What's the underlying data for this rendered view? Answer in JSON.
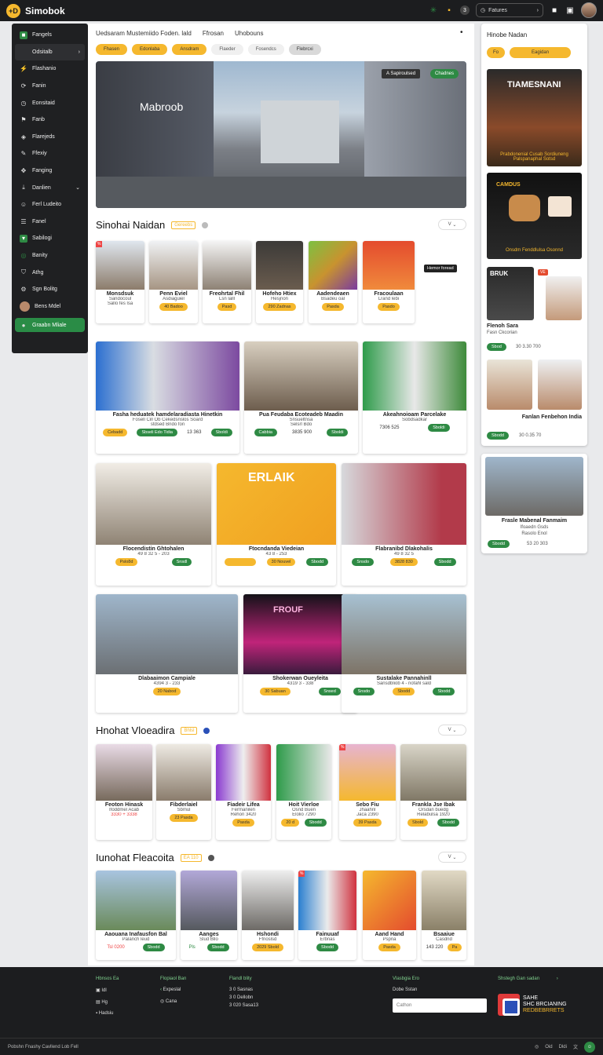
{
  "topbar": {
    "brand": "Simobok",
    "logo": "+D",
    "search_label": "Fatures",
    "icons": [
      "plant-icon",
      "clip-icon",
      "clock-icon",
      "search-icon",
      "bell-icon",
      "grid-icon",
      "avatar"
    ]
  },
  "sidebar": {
    "items": [
      {
        "label": "Fangels",
        "icon": "square-icon"
      },
      {
        "label": "Odsitalb",
        "icon": "chevron-right-icon"
      },
      {
        "label": "Flashanio",
        "icon": "flash-icon"
      },
      {
        "label": "Fanin",
        "icon": "refresh-icon"
      },
      {
        "label": "Eonsitaid",
        "icon": "clock-icon"
      },
      {
        "label": "Fanb",
        "icon": "flag-icon"
      },
      {
        "label": "Flarejeds",
        "icon": "tag-icon"
      },
      {
        "label": "Ffexiy",
        "icon": "spark-icon"
      },
      {
        "label": "Fanging",
        "icon": "puzzle-icon"
      },
      {
        "label": "Danlien",
        "icon": "arrow-down-icon"
      },
      {
        "label": "Ferl Ludeito",
        "icon": "user-icon"
      },
      {
        "label": "Fanel",
        "icon": "list-icon"
      },
      {
        "label": "Sabilogi",
        "icon": "green-square-icon"
      },
      {
        "label": "Banity",
        "icon": "ring-icon"
      },
      {
        "label": "Athg",
        "icon": "shield-icon"
      },
      {
        "label": "Sgn Bolitg",
        "icon": "settings-icon"
      },
      {
        "label": "Bens Mdel",
        "icon": "avatar"
      },
      {
        "label": "Graabn Mliale",
        "icon": "green-circle-icon"
      }
    ]
  },
  "main": {
    "header": {
      "title": "Uedsaram Mustemiido Foden. lald",
      "second": "Ffrosan",
      "third": "Uhobouns",
      "dot": "•"
    },
    "chips": [
      "Fhasen",
      "Edonlaba",
      "Ansdram",
      "Flaeder",
      "Fosendcs",
      "Flebrcxi"
    ],
    "hero": {
      "sign": "Mabroob",
      "tag1": "A Sapiroulsed",
      "tag2": "Chadnes"
    },
    "section1": {
      "title": "Sinohai Naidan",
      "badge": "Gereebs",
      "sort": "V"
    },
    "row1": [
      {
        "title": "Monsdsuk",
        "sub": "Sandocoul",
        "meta": "Sallo fes lsa",
        "btn": ""
      },
      {
        "title": "Penn Eviel",
        "sub": "Asdiaguiel",
        "meta": "",
        "btn": "40 Badoo"
      },
      {
        "title": "Freohrtal Fhil",
        "sub": "Lsn lalll",
        "meta": "",
        "btn": "Pasd"
      },
      {
        "title": "Hofeho Htiex",
        "sub": "Hesjnon",
        "meta": "",
        "btn": "290 Zadnas"
      },
      {
        "title": "Aadendeaen",
        "sub": "Bsadeu oal",
        "meta": "",
        "btn": "Pasda"
      },
      {
        "title": "Fracoulaan",
        "sub": "Lrand lebi",
        "meta": "",
        "btn": "Pasdo"
      }
    ],
    "float_tag": "Hemor foread",
    "row2": [
      {
        "title": "Fasha heduatek hamdelaradiasta Hinetkin",
        "sub": "Fosell Cill Ob Cekedsnslos Soard",
        "meta": "stdsed Bndo fon",
        "b1": "Cebadd",
        "b2": "Sbseli Edo Tidia",
        "price": "13 363",
        "b3": "Sboldi"
      },
      {
        "title": "Pua Feudaba Ecoteadeb Maadin",
        "sub": "Snsueltnsa",
        "meta": "Selsrl Bdo",
        "b1": "Cabbia",
        "b2": "",
        "price": "3835 900",
        "b3": "Sboldi"
      },
      {
        "title": "Akeahnoioam Parcelake",
        "sub": "Sobdsadkar",
        "meta": "",
        "b1": "",
        "b2": "",
        "price": "7306 525",
        "b3": "Sboldi"
      }
    ],
    "row3": [
      {
        "title": "Flocendistin Ghtohalen",
        "sub": "49 8 32 5 - 203",
        "b1": "Pslo8d",
        "b2": "Snsdl"
      },
      {
        "title": "Ftocndanda Viedeian",
        "sub": "43 8 - 253",
        "b1": "",
        "b2": "30 Nouvel",
        "b3": "Sbodd"
      },
      {
        "title": "Flabranibd Dlakohalis",
        "sub": "49 8 32 5",
        "b1": "Snsdo",
        "b2": "3828 830",
        "b3": "Sbodd"
      }
    ],
    "promo_text": "ERLAIK",
    "row4": [
      {
        "title": "Dlabaaimon Campiale",
        "sub": "4394 3 - 233",
        "b1": "20 Nabod"
      },
      {
        "title": "Shokerwan Oueyleita",
        "sub": "4319 3 - 338",
        "b1": "30 Sabuan",
        "b2": "Snsed"
      },
      {
        "title": "Sustalake Pannahinll",
        "sub": "Sansdbliob 4 - nofahl sald",
        "b1": "Snsdo",
        "b2": "Sbodd",
        "b3": "Sbodd"
      }
    ],
    "store_sign": "FROUF",
    "section2": {
      "title": "Hnohat Vloeadira",
      "badge": "Bhlsl",
      "sort": "V"
    },
    "row5": [
      {
        "title": "Feoton Hinask",
        "sub": "Ifoddmel Acab",
        "meta": "3330 + 3338",
        "b1": "",
        "b2": ""
      },
      {
        "title": "Fibderlaiel",
        "sub": "Sbmul",
        "meta": "",
        "b1": "23 Pasda",
        "b2": ""
      },
      {
        "title": "Fiadeir Lifea",
        "sub": "Fermanilen",
        "meta": "Rehon 3420",
        "b1": "Pasda",
        "b2": ""
      },
      {
        "title": "Hoit Vierloe",
        "sub": "Osnd Buen",
        "meta": "Elolio 7290",
        "b1": "20 d",
        "b2": "Sbodd"
      },
      {
        "title": "Sebo Fiu",
        "sub": "Jhaahnl",
        "meta": "Jaca 2390",
        "b1": "39 Pasda",
        "b2": ""
      },
      {
        "title": "Frankla Jse Ibak",
        "sub": "Orsdan buedg",
        "meta": "Relabulsa 1920",
        "b1": "Sbold",
        "b2": "Sbodd"
      }
    ],
    "section3": {
      "title": "Iunohat Fleacoita",
      "badge": "EA 110",
      "sort": "V"
    },
    "row6": [
      {
        "title": "Aaouana Inafausfon Bal",
        "sub": "Palanch leud",
        "meta": "Tsl 0200",
        "b1": "Sbodd"
      },
      {
        "title": "Aanges",
        "sub": "Slud Bllo",
        "meta": "Pls",
        "b1": "Sbodd"
      },
      {
        "title": "Hshondi",
        "sub": "Ffnoslsd",
        "meta": "",
        "b1": "2029 Sbold"
      },
      {
        "title": "Fainuuaf",
        "sub": "Erbnas",
        "meta": "",
        "b1": "Sbodd"
      },
      {
        "title": "Aand Hand",
        "sub": "Pspna",
        "meta": "",
        "b1": "Pasda"
      },
      {
        "title": "Bsaaiue",
        "sub": "Casdnd",
        "meta": "143 220",
        "b1": "Pa"
      }
    ]
  },
  "right_panel": {
    "title": "Hinobe Nadan",
    "chips": [
      "Fo",
      "Eagidan"
    ],
    "img1": {
      "headline": "TIAMESNANI",
      "caption": "Prabdonenial Cusab Sordiuneng Palspanaphal Sotsd"
    },
    "img2": {
      "headline": "CAMDUS",
      "caption": "Onsdm Fenddlulsa Osonnd"
    },
    "card3": {
      "label": "BRUK",
      "badge": "VE",
      "title": "Flenoh Sara",
      "sub": "Fasn Ckcorian",
      "btn": "Sbod",
      "meta": "30 3.30 700"
    },
    "card4": {
      "title": "Fanlan Fenbehon India",
      "btn": "Sbodd",
      "meta": "30 0.35 70"
    }
  },
  "right_panel2": {
    "title": "Frasle Mabenal Fanmaim",
    "sub": "Ifoaedn Gsds",
    "meta": "Rasolo Enol",
    "btn": "Sbodd",
    "num": "53 20 303"
  },
  "footer": {
    "col1": {
      "head": "Hbnsos Ea",
      "items": [
        "Idl",
        "Hg",
        "Hadsiu"
      ]
    },
    "col2": {
      "head": "Flopiaol Ban",
      "items": [
        "Expeslal",
        "Cana"
      ]
    },
    "col3": {
      "head": "Flandl blity",
      "items": [
        "3 0 Sasnas",
        "3 0 Dellobn",
        "3 020 Sasa13"
      ]
    },
    "col4": {
      "head": "Vlasbgia Ero",
      "search_label": "Dobe Sstan",
      "placeholder": "Cathon"
    },
    "col5": {
      "head": "Shstegh Gan sadan",
      "brand_line1": "SAHE",
      "brand_line2": "SHC BRCIANING",
      "brand_line3": "REDBEBRRETS"
    },
    "bottom": "Pobshn Fnashy Cavllend Lob Fell",
    "bottom_right": [
      "Oid",
      "Dldi"
    ]
  }
}
